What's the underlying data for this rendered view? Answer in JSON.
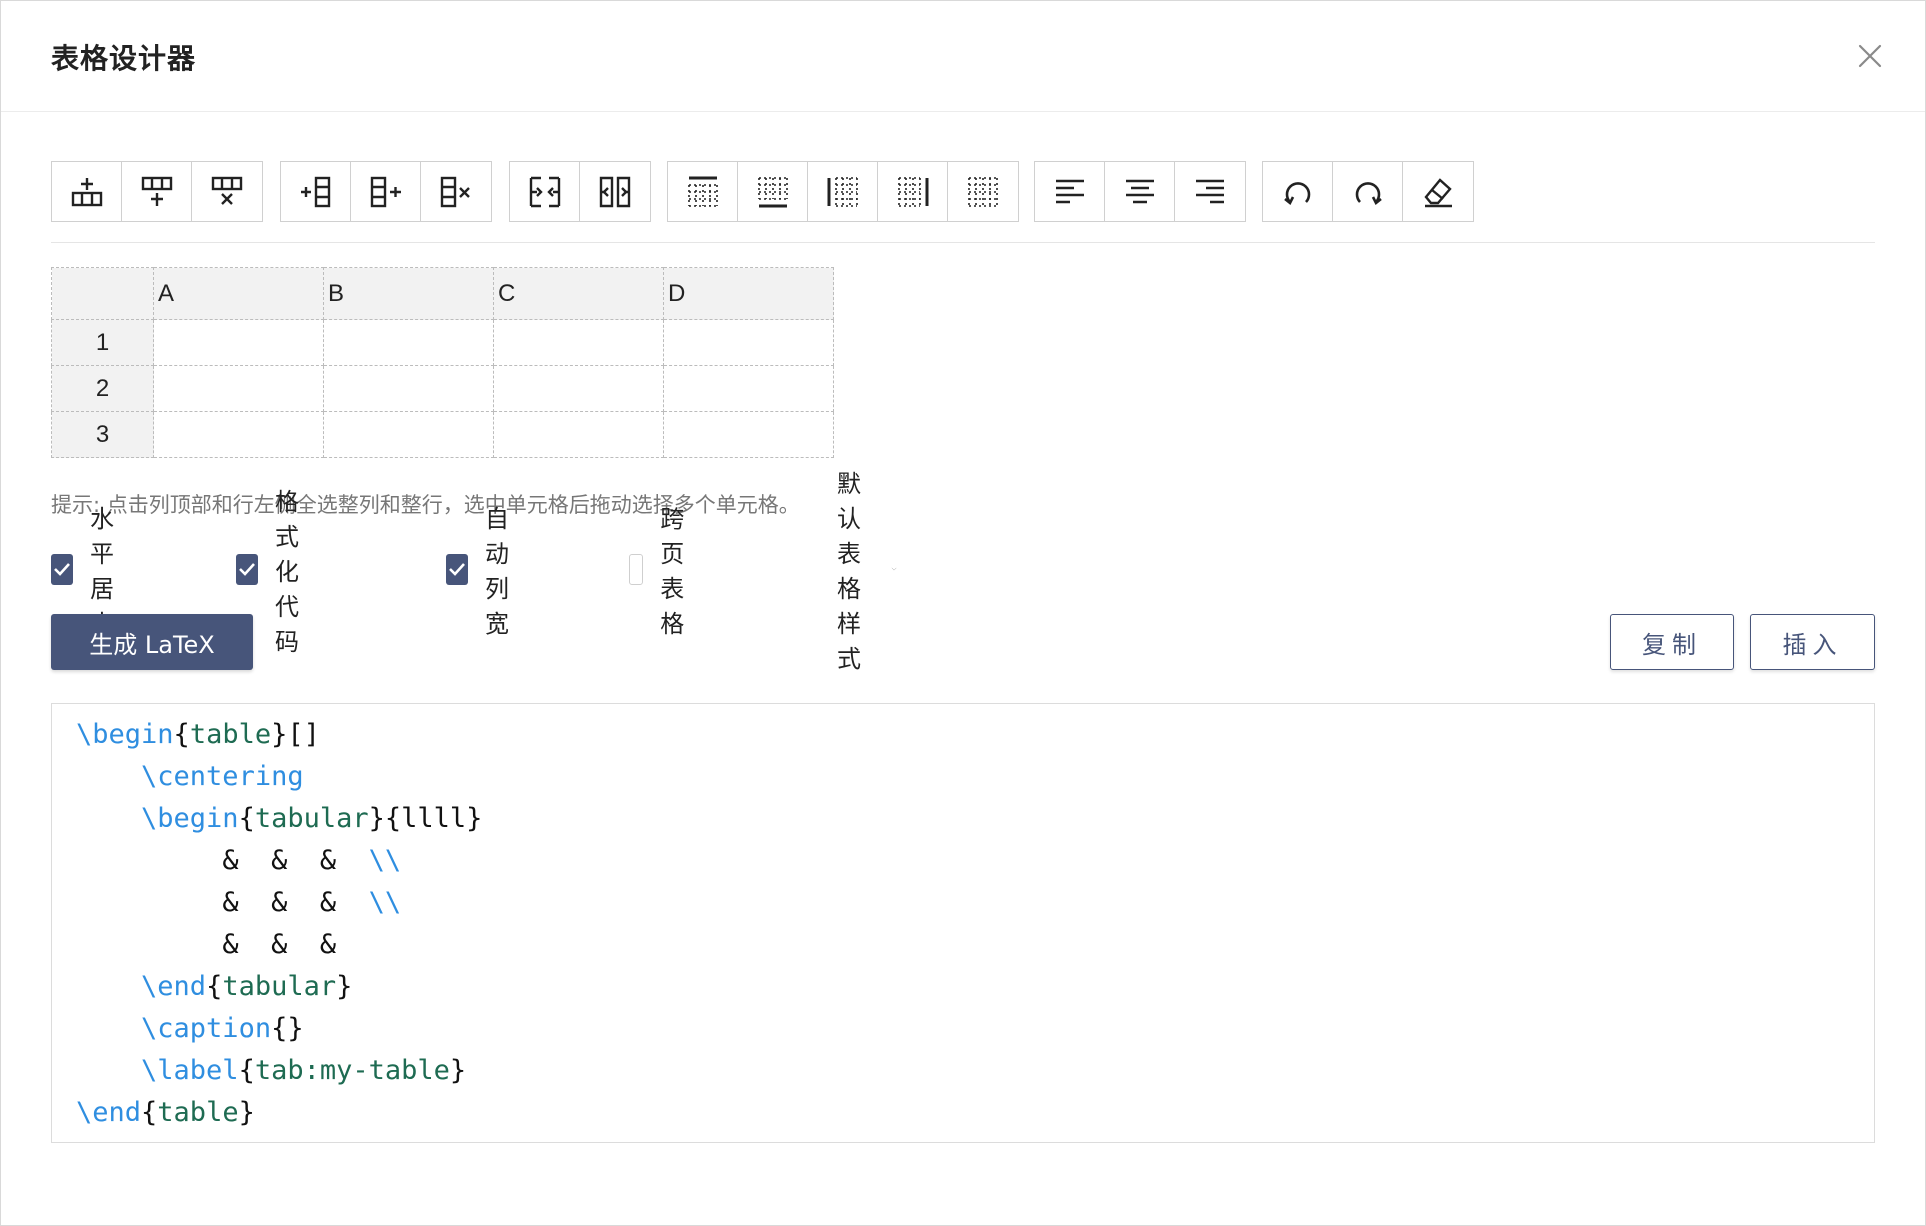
{
  "dialog": {
    "title": "表格设计器",
    "close_icon": "close-icon"
  },
  "toolbar": {
    "groups": [
      {
        "name": "row-ops",
        "buttons": [
          {
            "id": "insert-row-above",
            "icon": "insert-row-above-icon"
          },
          {
            "id": "insert-row-below",
            "icon": "insert-row-below-icon"
          },
          {
            "id": "delete-row",
            "icon": "delete-row-icon"
          }
        ]
      },
      {
        "name": "col-ops",
        "buttons": [
          {
            "id": "insert-col-left",
            "icon": "insert-col-left-icon"
          },
          {
            "id": "insert-col-right",
            "icon": "insert-col-right-icon"
          },
          {
            "id": "delete-col",
            "icon": "delete-col-icon"
          }
        ]
      },
      {
        "name": "merge-ops",
        "buttons": [
          {
            "id": "merge-cells",
            "icon": "merge-cells-icon"
          },
          {
            "id": "split-cells",
            "icon": "split-cells-icon"
          }
        ]
      },
      {
        "name": "border-ops",
        "buttons": [
          {
            "id": "border-top",
            "icon": "border-top-icon"
          },
          {
            "id": "border-bottom",
            "icon": "border-bottom-icon"
          },
          {
            "id": "border-left",
            "icon": "border-left-icon"
          },
          {
            "id": "border-right",
            "icon": "border-right-icon"
          },
          {
            "id": "border-none",
            "icon": "border-none-icon"
          }
        ]
      },
      {
        "name": "align-ops",
        "buttons": [
          {
            "id": "align-left",
            "icon": "align-left-icon"
          },
          {
            "id": "align-center",
            "icon": "align-center-icon"
          },
          {
            "id": "align-right",
            "icon": "align-right-icon"
          }
        ]
      },
      {
        "name": "history-ops",
        "buttons": [
          {
            "id": "undo",
            "icon": "undo-icon"
          },
          {
            "id": "redo",
            "icon": "redo-icon"
          },
          {
            "id": "clear",
            "icon": "eraser-icon"
          }
        ]
      }
    ]
  },
  "grid": {
    "columns": [
      "A",
      "B",
      "C",
      "D"
    ],
    "rows": [
      "1",
      "2",
      "3"
    ]
  },
  "hint": "提示: 点击列顶部和行左侧全选整列和整行，选中单元格后拖动选择多个单元格。",
  "options": {
    "items": [
      {
        "label": "水平居中",
        "checked": true
      },
      {
        "label": "格式化代码",
        "checked": true
      },
      {
        "label": "自动列宽",
        "checked": true
      },
      {
        "label": "跨页表格",
        "checked": false
      }
    ],
    "style_select": {
      "value": "默认表格样式",
      "icon": "chevron-down-icon"
    }
  },
  "actions": {
    "generate_label": "生成 LaTeX",
    "copy_label": "复制",
    "insert_label": "插入"
  },
  "colors": {
    "accent": "#47557a",
    "latex_command": "#2f8ee0",
    "latex_argument": "#1e6b52"
  },
  "code": {
    "lines": [
      {
        "indent": "",
        "parts": [
          [
            "kw",
            "\\begin"
          ],
          [
            "pl",
            "{"
          ],
          [
            "arg",
            "table"
          ],
          [
            "pl",
            "}[]"
          ]
        ]
      },
      {
        "indent": "    ",
        "parts": [
          [
            "kw",
            "\\centering"
          ]
        ]
      },
      {
        "indent": "    ",
        "parts": [
          [
            "kw",
            "\\begin"
          ],
          [
            "pl",
            "{"
          ],
          [
            "arg",
            "tabular"
          ],
          [
            "pl",
            "}{llll}"
          ]
        ]
      },
      {
        "indent": "         ",
        "parts": [
          [
            "pl",
            "&  &  &  "
          ],
          [
            "kw",
            "\\\\"
          ]
        ]
      },
      {
        "indent": "         ",
        "parts": [
          [
            "pl",
            "&  &  &  "
          ],
          [
            "kw",
            "\\\\"
          ]
        ]
      },
      {
        "indent": "         ",
        "parts": [
          [
            "pl",
            "&  &  &"
          ]
        ]
      },
      {
        "indent": "    ",
        "parts": [
          [
            "kw",
            "\\end"
          ],
          [
            "pl",
            "{"
          ],
          [
            "arg",
            "tabular"
          ],
          [
            "pl",
            "}"
          ]
        ]
      },
      {
        "indent": "    ",
        "parts": [
          [
            "kw",
            "\\caption"
          ],
          [
            "pl",
            "{}"
          ]
        ]
      },
      {
        "indent": "    ",
        "parts": [
          [
            "kw",
            "\\label"
          ],
          [
            "pl",
            "{"
          ],
          [
            "arg",
            "tab:my-table"
          ],
          [
            "pl",
            "}"
          ]
        ]
      },
      {
        "indent": "",
        "parts": [
          [
            "kw",
            "\\end"
          ],
          [
            "pl",
            "{"
          ],
          [
            "arg",
            "table"
          ],
          [
            "pl",
            "}"
          ]
        ]
      }
    ]
  }
}
